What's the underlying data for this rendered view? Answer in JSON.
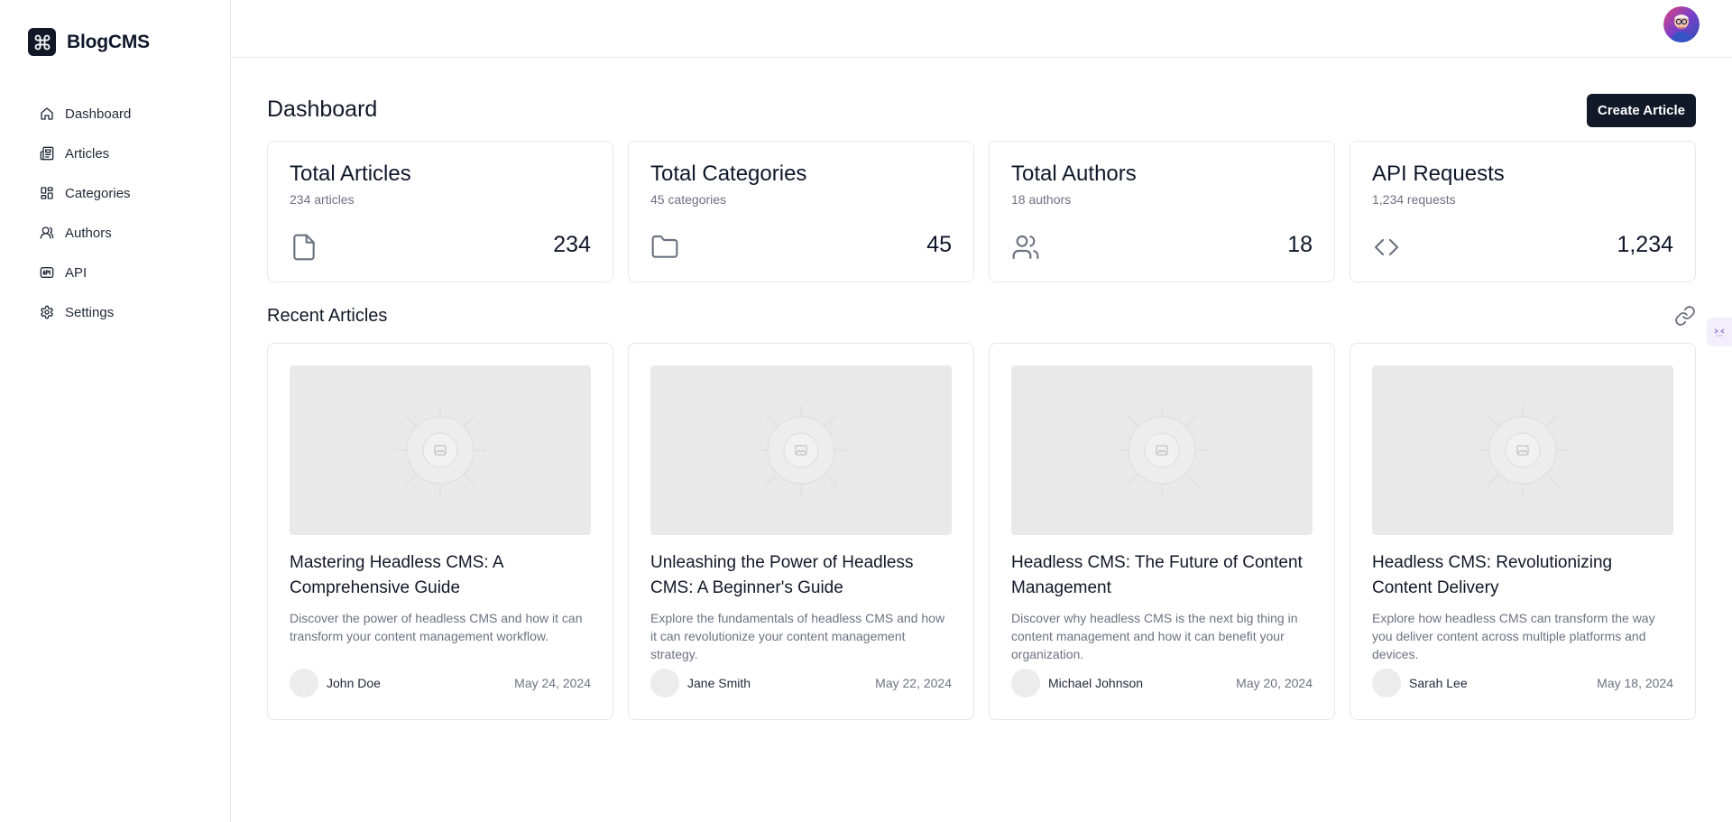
{
  "brand": {
    "name": "BlogCMS",
    "logo_icon": "command-icon"
  },
  "sidebar": {
    "items": [
      {
        "label": "Dashboard",
        "icon": "home-icon"
      },
      {
        "label": "Articles",
        "icon": "newspaper-icon"
      },
      {
        "label": "Categories",
        "icon": "grid-icon"
      },
      {
        "label": "Authors",
        "icon": "users-icon"
      },
      {
        "label": "API",
        "icon": "api-icon"
      },
      {
        "label": "Settings",
        "icon": "gear-icon"
      }
    ]
  },
  "header": {
    "avatar": "user-avatar"
  },
  "main": {
    "title": "Dashboard",
    "create_label": "Create Article",
    "stats": [
      {
        "title": "Total Articles",
        "sub": "234 articles",
        "value": "234",
        "icon": "file-icon"
      },
      {
        "title": "Total Categories",
        "sub": "45 categories",
        "value": "45",
        "icon": "folder-icon"
      },
      {
        "title": "Total Authors",
        "sub": "18 authors",
        "value": "18",
        "icon": "users-icon"
      },
      {
        "title": "API Requests",
        "sub": "1,234 requests",
        "value": "1,234",
        "icon": "code-icon"
      }
    ],
    "recent_title": "Recent Articles",
    "articles": [
      {
        "title": "Mastering Headless CMS: A Comprehensive Guide",
        "excerpt": "Discover the power of headless CMS and how it can transform your content management workflow.",
        "author": "John Doe",
        "date": "May 24, 2024"
      },
      {
        "title": "Unleashing the Power of Headless CMS: A Beginner's Guide",
        "excerpt": "Explore the fundamentals of headless CMS and how it can revolutionize your content management strategy.",
        "author": "Jane Smith",
        "date": "May 22, 2024"
      },
      {
        "title": "Headless CMS: The Future of Content Management",
        "excerpt": "Discover why headless CMS is the next big thing in content management and how it can benefit your organization.",
        "author": "Michael Johnson",
        "date": "May 20, 2024"
      },
      {
        "title": "Headless CMS: Revolutionizing Content Delivery",
        "excerpt": "Explore how headless CMS can transform the way you deliver content across multiple platforms and devices.",
        "author": "Sarah Lee",
        "date": "May 18, 2024"
      }
    ]
  },
  "colors": {
    "primary": "#111827",
    "muted": "#6b7280",
    "border": "#e5e7eb",
    "placeholder": "#e9e9e9"
  }
}
